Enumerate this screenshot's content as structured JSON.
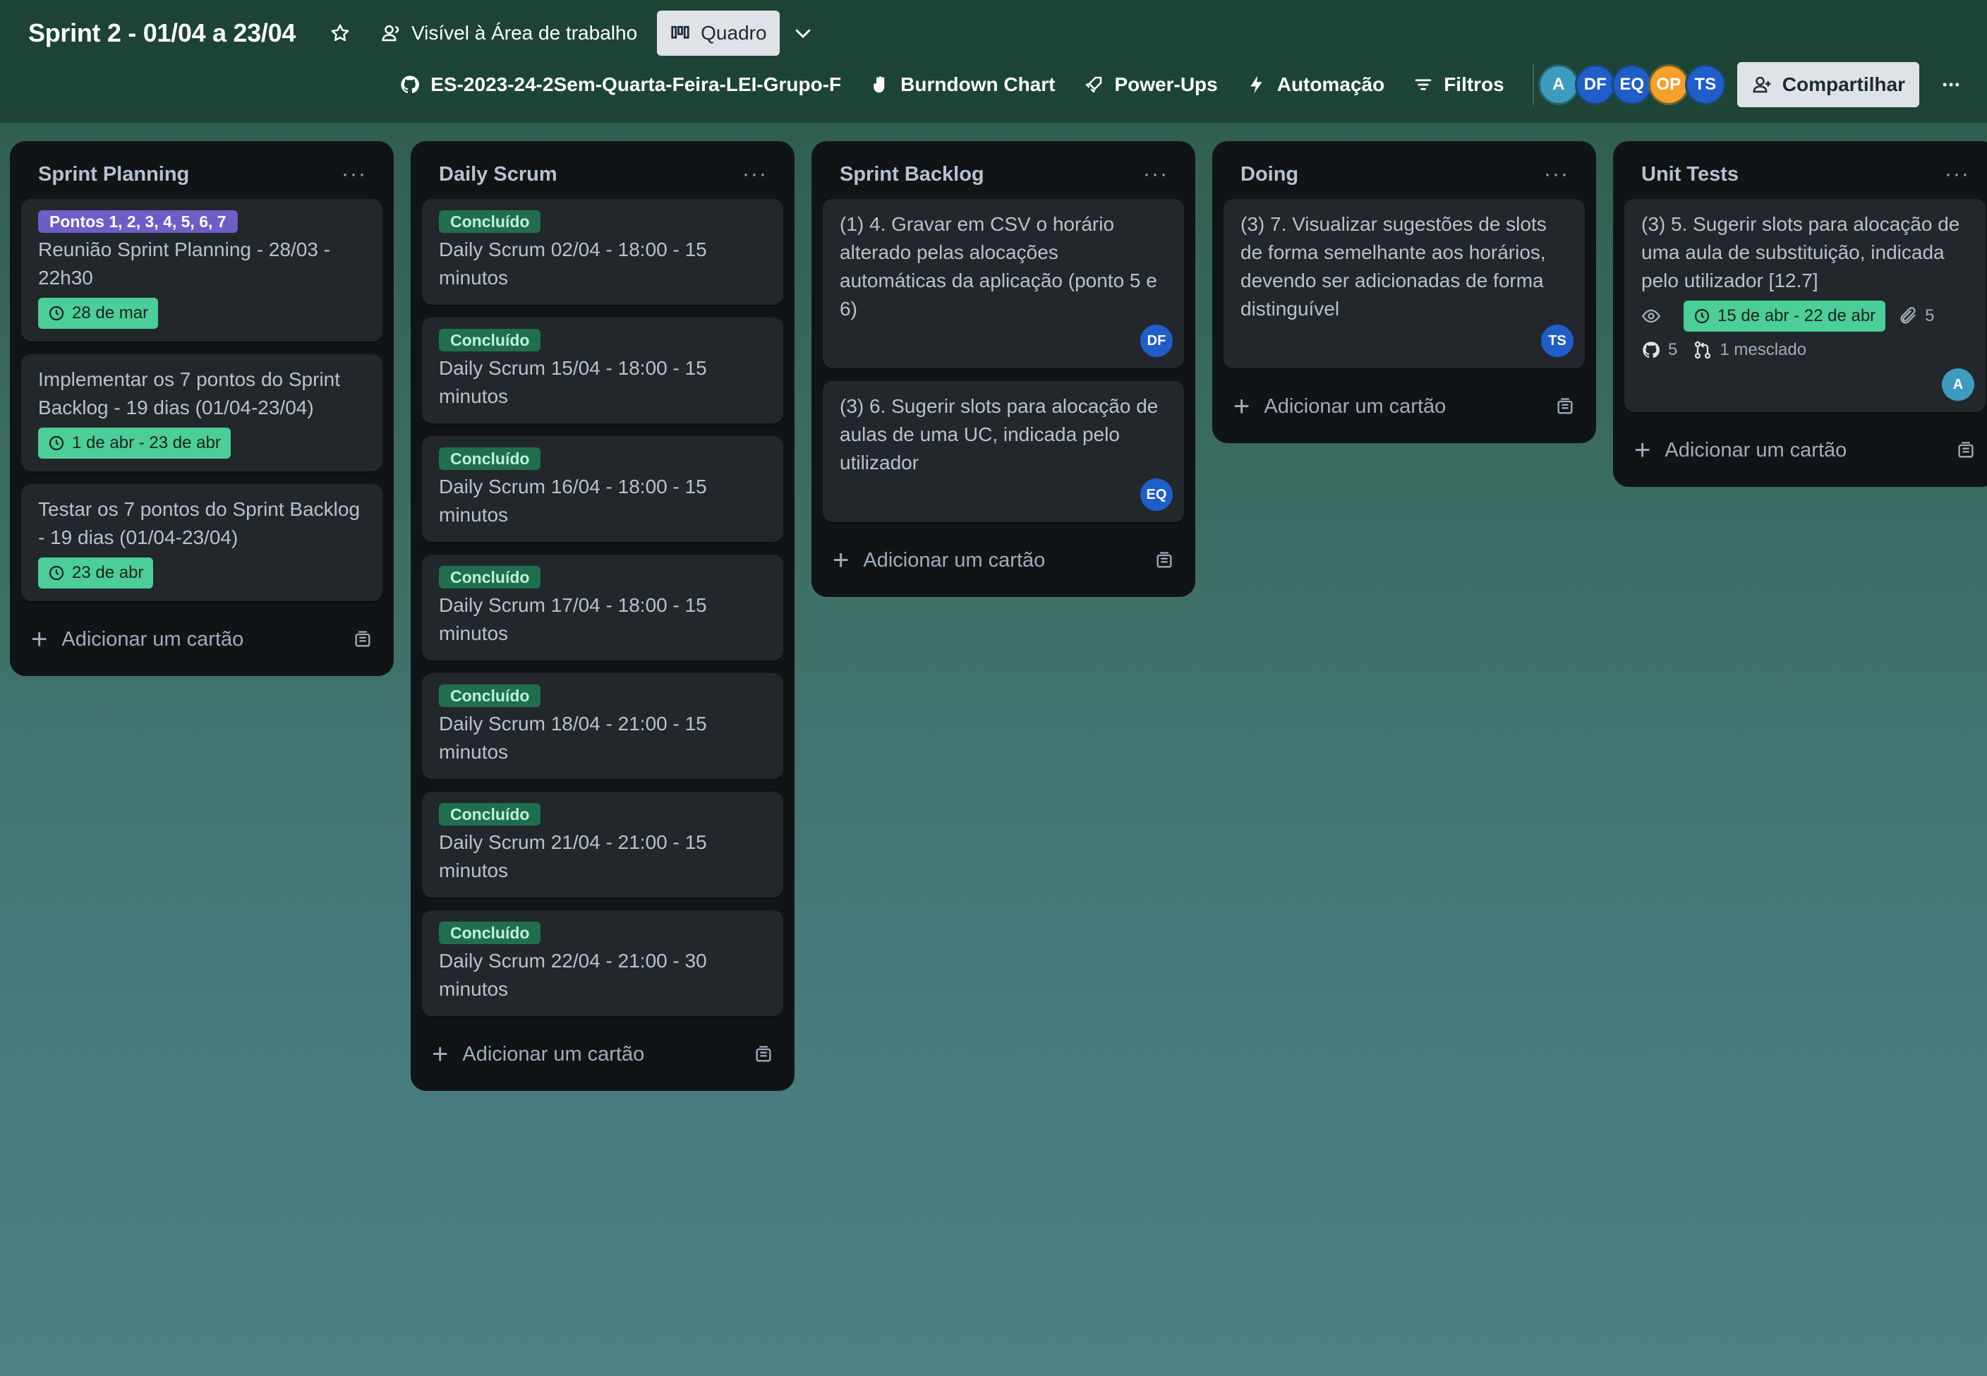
{
  "header": {
    "title": "Sprint 2 - 01/04 a 23/04",
    "visibility_label": "Visível à Área de trabalho",
    "view_label": "Quadro",
    "repo_label": "ES-2023-24-2Sem-Quarta-Feira-LEI-Grupo-F",
    "burndown_label": "Burndown Chart",
    "powerups_label": "Power-Ups",
    "automation_label": "Automação",
    "filters_label": "Filtros",
    "share_label": "Compartilhar",
    "members": [
      {
        "initials": "A",
        "color": "#3d9bbf"
      },
      {
        "initials": "DF",
        "color": "#1f5dc9"
      },
      {
        "initials": "EQ",
        "color": "#1f5dc9"
      },
      {
        "initials": "OP",
        "color": "#f5a02b"
      },
      {
        "initials": "TS",
        "color": "#1f5dc9"
      }
    ]
  },
  "add_card_label": "Adicionar um cartão",
  "lists": [
    {
      "title": "Sprint Planning",
      "cards": [
        {
          "label": "Pontos 1, 2, 3, 4, 5, 6, 7",
          "text": "Reunião Sprint Planning - 28/03 - 22h30",
          "date": "28 de mar"
        },
        {
          "text": "Implementar os 7 pontos do Sprint Backlog - 19 dias (01/04-23/04)",
          "date": "1 de abr - 23 de abr"
        },
        {
          "text": "Testar os 7 pontos do Sprint Backlog - 19 dias (01/04-23/04)",
          "date": "23 de abr"
        }
      ]
    },
    {
      "title": "Daily Scrum",
      "cards": [
        {
          "label": "Concluído",
          "text": "Daily Scrum 02/04 - 18:00 - 15 minutos"
        },
        {
          "label": "Concluído",
          "text": "Daily Scrum 15/04 - 18:00 - 15 minutos"
        },
        {
          "label": "Concluído",
          "text": "Daily Scrum 16/04 - 18:00 - 15 minutos"
        },
        {
          "label": "Concluído",
          "text": "Daily Scrum 17/04 - 18:00 - 15 minutos"
        },
        {
          "label": "Concluído",
          "text": "Daily Scrum 18/04 - 21:00 - 15 minutos"
        },
        {
          "label": "Concluído",
          "text": "Daily Scrum 21/04 - 21:00 - 15 minutos"
        },
        {
          "label": "Concluído",
          "text": "Daily Scrum 22/04 - 21:00 - 30 minutos"
        }
      ]
    },
    {
      "title": "Sprint Backlog",
      "cards": [
        {
          "text": "(1) 4. Gravar em CSV o horário alterado pelas alocações automáticas da aplicação (ponto 5 e 6)",
          "member": "DF",
          "member_color": "#1f5dc9"
        },
        {
          "text": "(3) 6. Sugerir slots para alocação de aulas de uma UC, indicada pelo utilizador",
          "member": "EQ",
          "member_color": "#1f5dc9"
        }
      ]
    },
    {
      "title": "Doing",
      "cards": [
        {
          "text": "(3) 7. Visualizar sugestões de slots de forma semelhante aos horários, devendo ser adicionadas de forma distinguível",
          "member": "TS",
          "member_color": "#1f5dc9"
        }
      ]
    },
    {
      "title": "Unit Tests",
      "cards": [
        {
          "text": "(3) 5. Sugerir slots para alocação de uma aula de substituição, indicada pelo utilizador [12.7]",
          "date": "15 de abr - 22 de abr",
          "attachments": "5",
          "github_count": "5",
          "merged": "1 mesclado",
          "member": "A",
          "member_color": "#3d9bbf"
        }
      ]
    }
  ]
}
